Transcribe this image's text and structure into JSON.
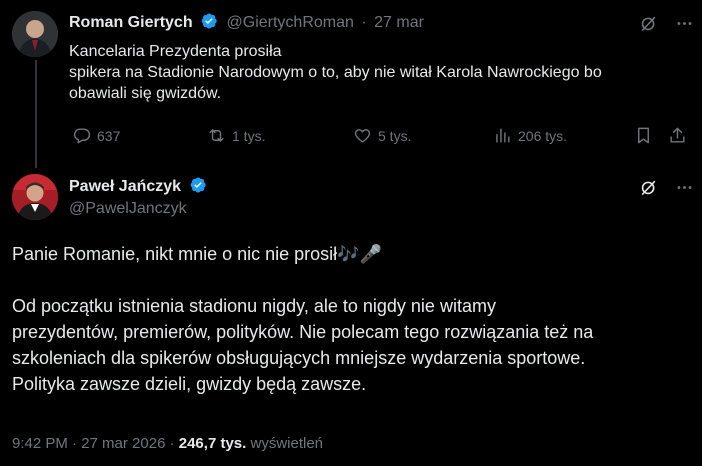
{
  "post1": {
    "name": "Roman Giertych",
    "handle": "@GiertychRoman",
    "separator": "·",
    "time": "27 mar",
    "lines": [
      "Kancelaria Prezydenta prosiła",
      "spikera na Stadionie Narodowym o to, aby nie witał Karola Nawrockiego bo",
      "obawiali się gwizdów."
    ],
    "actions": {
      "replies": "637",
      "reposts": "1 tys.",
      "likes": "5 tys.",
      "views": "206 tys."
    }
  },
  "post2": {
    "name": "Paweł Jańczyk",
    "handle": "@PawelJanczyk",
    "paragraph1": "Panie Romanie, nikt mnie o nic nie prosił🎶🎤",
    "paragraph2_lines": [
      "Od początku istnienia stadionu nigdy, ale to nigdy nie witamy",
      "prezydentów, premierów, polityków. Nie polecam tego rozwiązania też na",
      "szkoleniach dla spikerów obsługujących mniejsze wydarzenia sportowe.",
      "Polityka zawsze dzieli, gwizdy będą zawsze."
    ],
    "timestamp": "9:42 PM · 27 mar 2026 ·",
    "views_count": "246,7 tys.",
    "views_label": "wyświetleń"
  },
  "colors": {
    "background": "#000000",
    "text": "#e7e9ea",
    "muted": "#71767b",
    "verified": "#1d9bf0",
    "thread_line": "#333639"
  }
}
